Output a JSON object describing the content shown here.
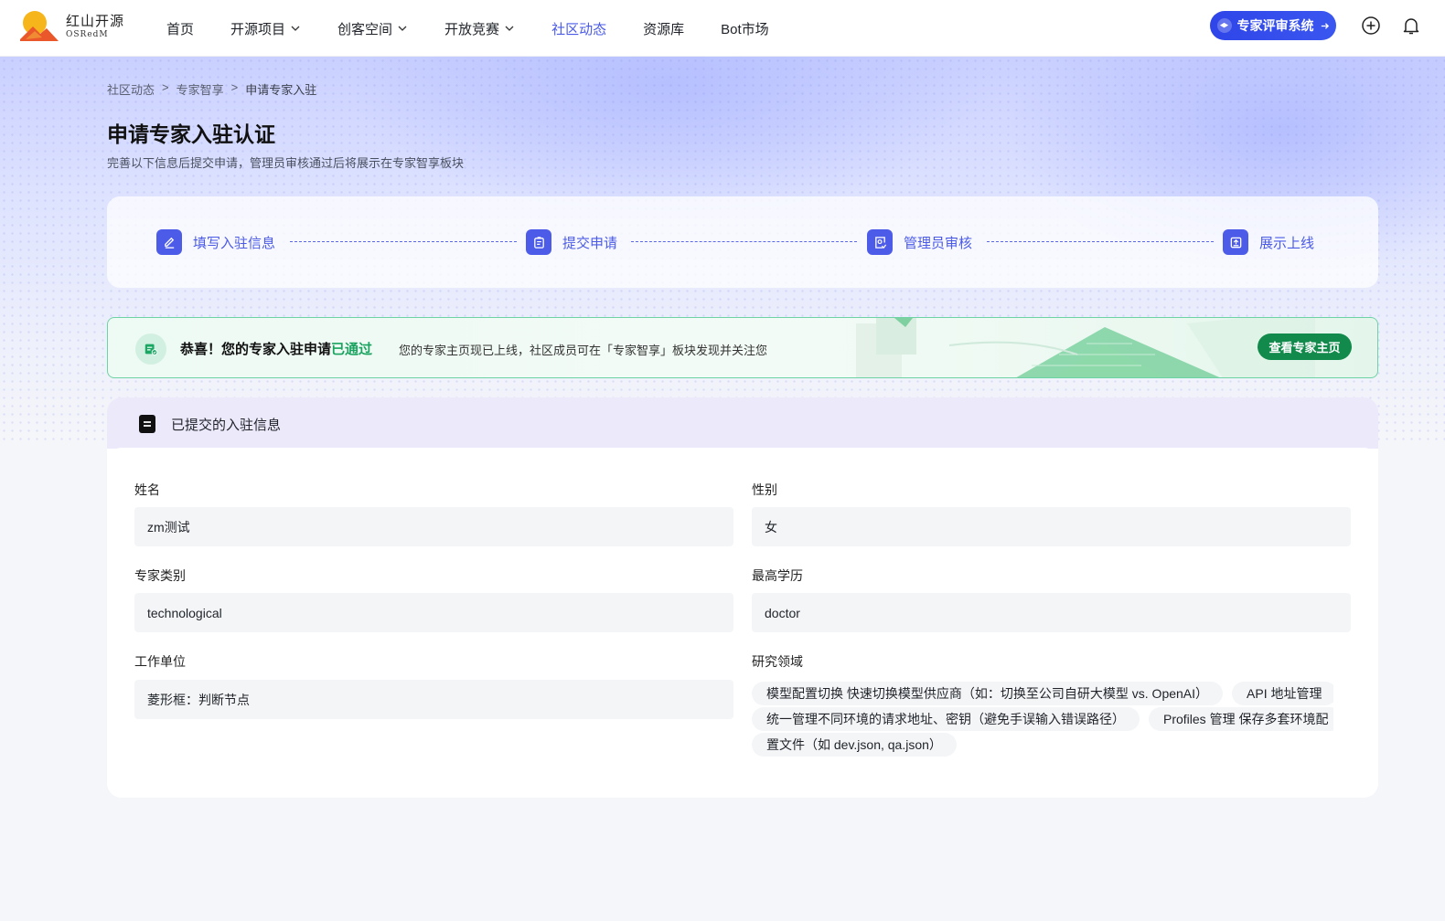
{
  "header": {
    "logo_title": "红山开源",
    "logo_sub": "OSRedM",
    "nav": [
      {
        "label": "首页",
        "dropdown": false,
        "active": false
      },
      {
        "label": "开源项目",
        "dropdown": true,
        "active": false
      },
      {
        "label": "创客空间",
        "dropdown": true,
        "active": false
      },
      {
        "label": "开放竞赛",
        "dropdown": true,
        "active": false
      },
      {
        "label": "社区动态",
        "dropdown": false,
        "active": true
      },
      {
        "label": "资源库",
        "dropdown": false,
        "active": false
      },
      {
        "label": "Bot市场",
        "dropdown": false,
        "active": false
      }
    ],
    "expert_system_label": "专家评审系统",
    "icons": [
      "plus-circle-icon",
      "bell-icon"
    ]
  },
  "breadcrumb": {
    "items": [
      "社区动态",
      "专家智享",
      "申请专家入驻"
    ],
    "separator": ">"
  },
  "page": {
    "title": "申请专家入驻认证",
    "subtitle": "完善以下信息后提交申请，管理员审核通过后将展示在专家智享板块"
  },
  "steps": [
    {
      "label": "填写入驻信息",
      "icon": "edit-icon"
    },
    {
      "label": "提交申请",
      "icon": "clipboard-icon"
    },
    {
      "label": "管理员审核",
      "icon": "review-icon"
    },
    {
      "label": "展示上线",
      "icon": "publish-icon"
    }
  ],
  "banner": {
    "title_prefix": "恭喜！您的专家入驻申请",
    "title_status": "已通过",
    "description": "您的专家主页现已上线，社区成员可在「专家智享」板块发现并关注您",
    "button_label": "查看专家主页"
  },
  "info": {
    "section_title": "已提交的入驻信息",
    "fields": {
      "name": {
        "label": "姓名",
        "value": "zm测试"
      },
      "gender": {
        "label": "性别",
        "value": "女"
      },
      "category": {
        "label": "专家类别",
        "value": "technological"
      },
      "education": {
        "label": "最高学历",
        "value": "doctor"
      },
      "employer": {
        "label": "工作单位",
        "value": "菱形框：判断节点"
      },
      "research": {
        "label": "研究领域",
        "tags": [
          "模型配置切换 快速切换模型供应商（如：切换至公司自研大模型 vs. OpenAI）",
          "API 地址管理 统一管理不同环境的请求地址、密钥（避免手误输入错误路径）",
          "Profiles 管理 保存多套环境配置文件（如 dev.json, qa.json）"
        ]
      }
    }
  },
  "colors": {
    "accent": "#4b5be6",
    "success": "#19a35f",
    "success_button": "#128a4c",
    "expert_button": "#2f45e8"
  }
}
